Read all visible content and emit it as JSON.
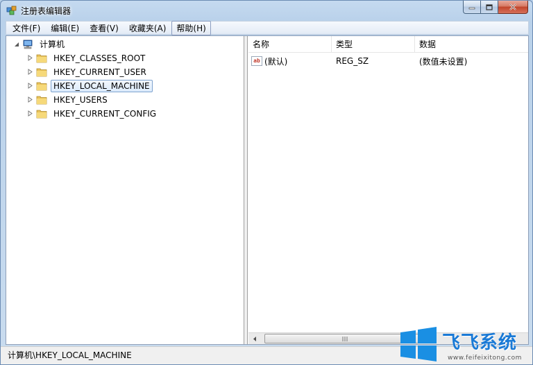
{
  "window": {
    "title": "注册表编辑器"
  },
  "menu": [
    {
      "label": "文件(F)"
    },
    {
      "label": "编辑(E)"
    },
    {
      "label": "查看(V)"
    },
    {
      "label": "收藏夹(A)"
    },
    {
      "label": "帮助(H)"
    }
  ],
  "tree": {
    "root": "计算机",
    "keys": [
      {
        "label": "HKEY_CLASSES_ROOT"
      },
      {
        "label": "HKEY_CURRENT_USER"
      },
      {
        "label": "HKEY_LOCAL_MACHINE"
      },
      {
        "label": "HKEY_USERS"
      },
      {
        "label": "HKEY_CURRENT_CONFIG"
      }
    ],
    "selected_index": 2
  },
  "list": {
    "columns": [
      "名称",
      "类型",
      "数据"
    ],
    "rows": [
      {
        "name": "(默认)",
        "type": "REG_SZ",
        "data": "(数值未设置)"
      }
    ]
  },
  "statusbar": {
    "path": "计算机\\HKEY_LOCAL_MACHINE"
  },
  "watermark": {
    "brand": "飞飞系统",
    "url": "www.feifeixitong.com"
  },
  "colors": {
    "selection_border": "#7da2ce",
    "watermark_blue": "#1a7ad6"
  }
}
